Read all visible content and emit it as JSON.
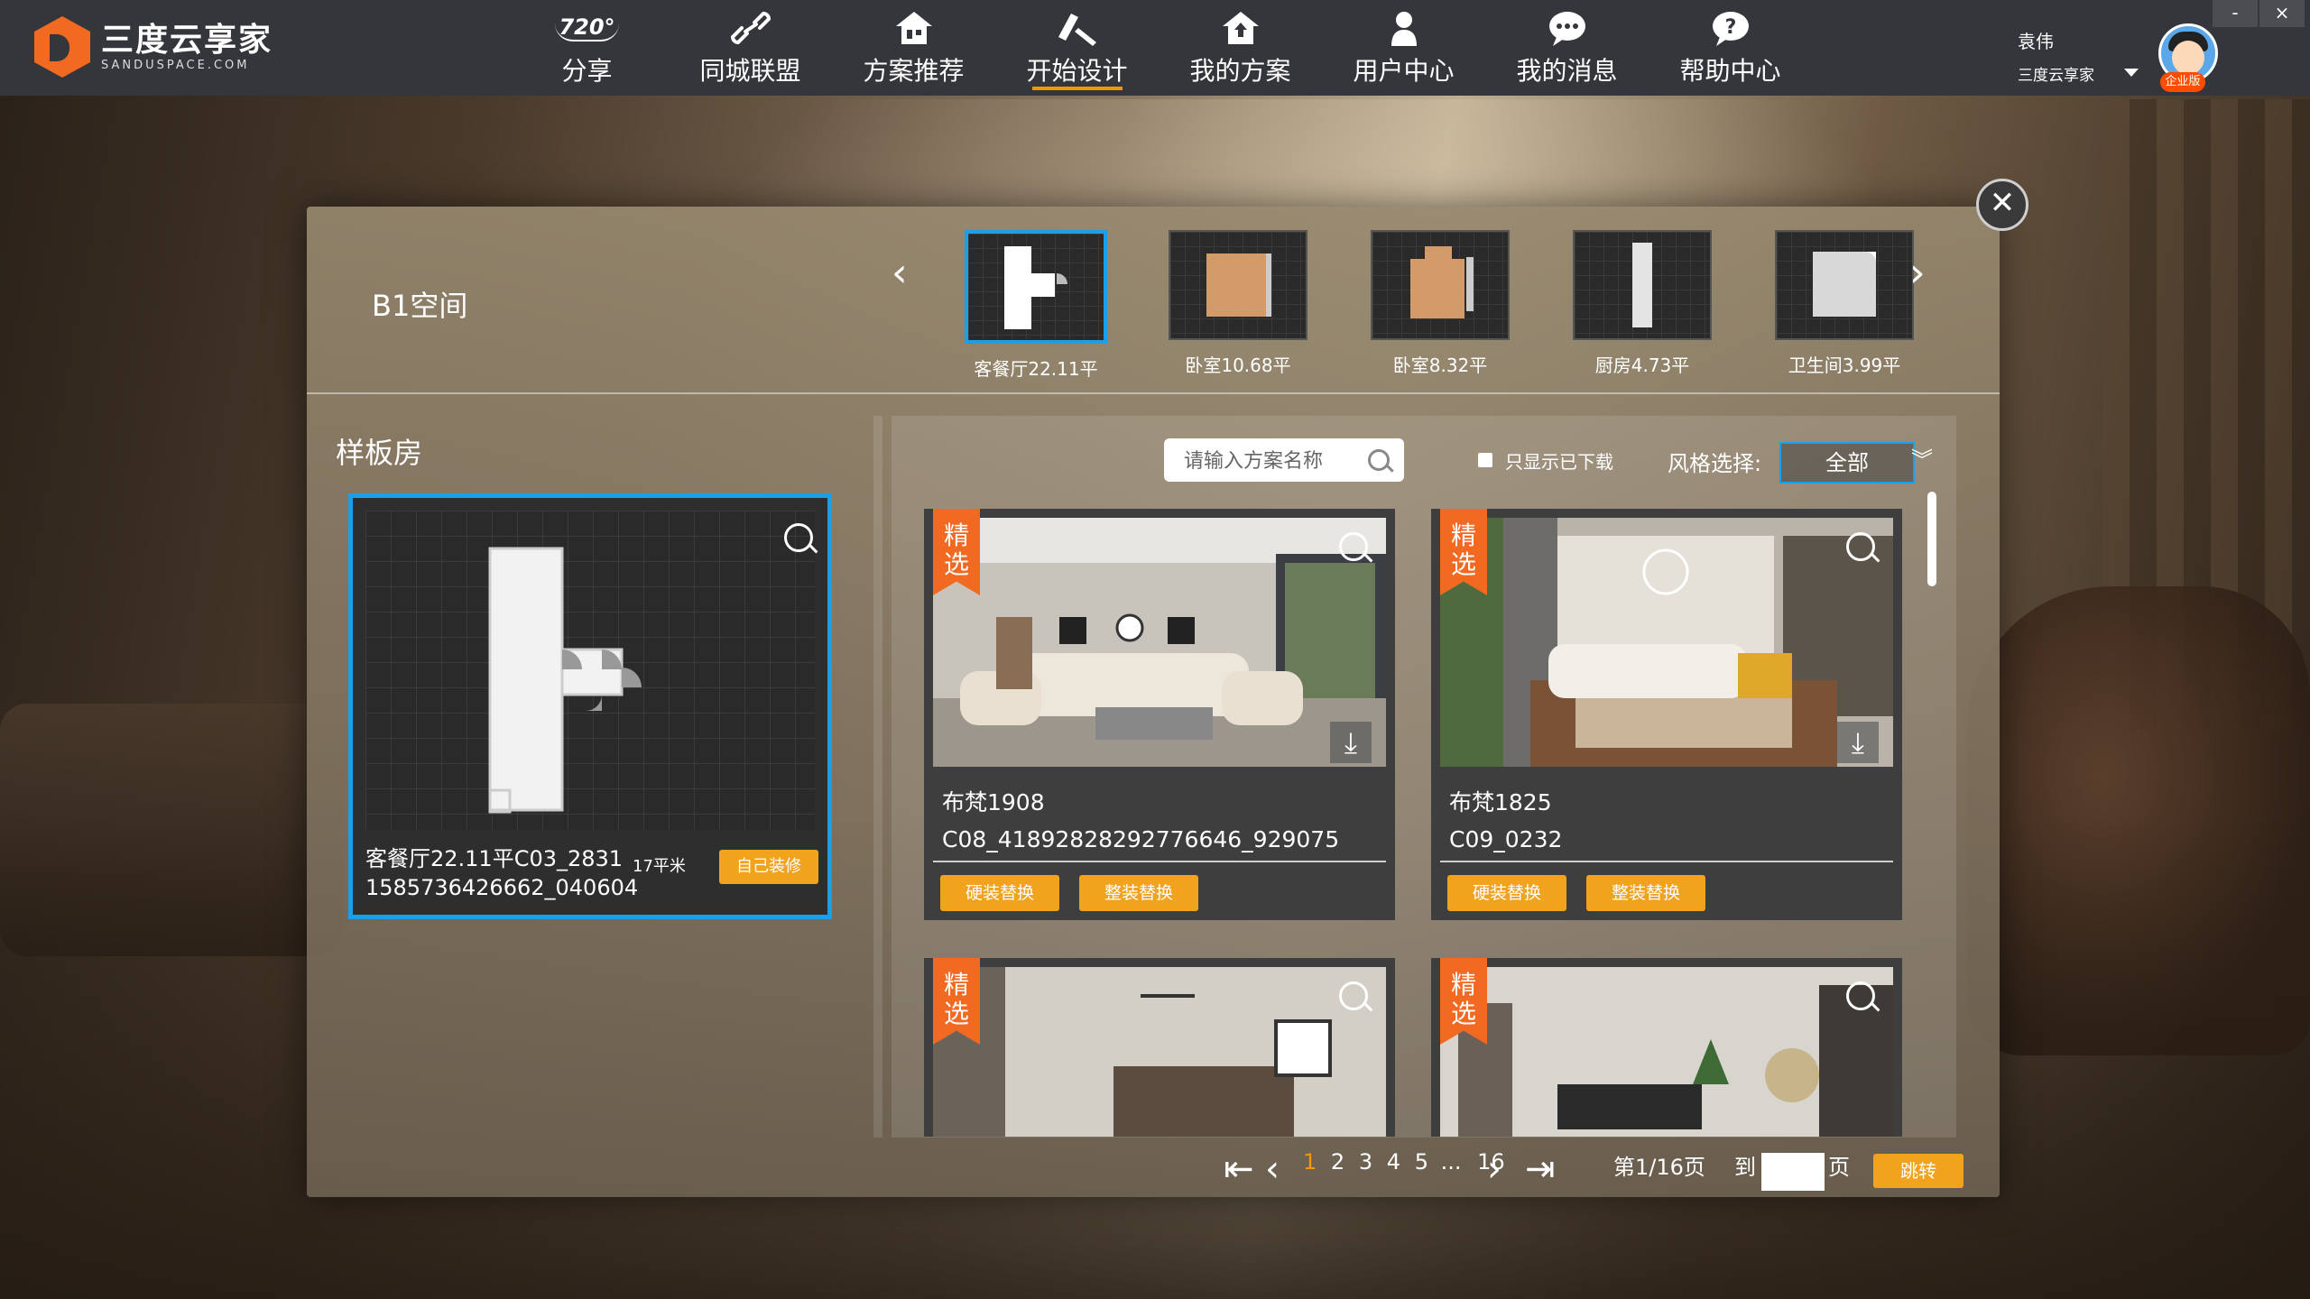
{
  "app": {
    "logo_title": "三度云享家",
    "logo_sub": "SANDUSPACE.COM"
  },
  "nav": [
    {
      "label": "分享",
      "icon": "720-icon"
    },
    {
      "label": "同城联盟",
      "icon": "link-icon"
    },
    {
      "label": "方案推荐",
      "icon": "house-icon"
    },
    {
      "label": "开始设计",
      "icon": "design-tools-icon"
    },
    {
      "label": "我的方案",
      "icon": "upload-house-icon"
    },
    {
      "label": "用户中心",
      "icon": "user-icon"
    },
    {
      "label": "我的消息",
      "icon": "message-icon"
    },
    {
      "label": "帮助中心",
      "icon": "help-icon"
    }
  ],
  "nav_icon_720": "720°",
  "user": {
    "name": "袁伟",
    "org": "三度云享家",
    "badge": "企业版"
  },
  "window": {
    "minimize": "-",
    "close": "×"
  },
  "dialog": {
    "close": "✕",
    "space_title": "B1空间",
    "rooms": [
      {
        "label": "客餐厅22.11平"
      },
      {
        "label": "卧室10.68平"
      },
      {
        "label": "卧室8.32平"
      },
      {
        "label": "厨房4.73平"
      },
      {
        "label": "卫生间3.99平"
      }
    ],
    "left_title": "样板房",
    "sample": {
      "name_line1": "客餐厅22.11平C03_2831",
      "name_line2": "1585736426662_040604",
      "area": "17平米",
      "button": "自己装修"
    },
    "search": {
      "placeholder": "请输入方案名称"
    },
    "filter_label": "只显示已下载",
    "style_label": "风格选择:",
    "style_value": "全部",
    "cards": [
      {
        "tag": "精选",
        "name": "布梵1908",
        "code": "C08_41892828292776646_929075",
        "btn1": "硬装替换",
        "btn2": "整装替换"
      },
      {
        "tag": "精选",
        "name": "布梵1825",
        "code": "C09_0232",
        "btn1": "硬装替换",
        "btn2": "整装替换"
      },
      {
        "tag": "精选"
      },
      {
        "tag": "精选"
      }
    ],
    "pager": {
      "pages": [
        "1",
        "2",
        "3",
        "4",
        "5",
        "...",
        "16"
      ],
      "status": "第1/16页",
      "goto": "到",
      "page_unit": "页",
      "jump": "跳转"
    }
  },
  "colors": {
    "accent": "#f39800",
    "brand": "#f26a21",
    "selected": "#1aa0e8",
    "button": "#f1a31e"
  }
}
